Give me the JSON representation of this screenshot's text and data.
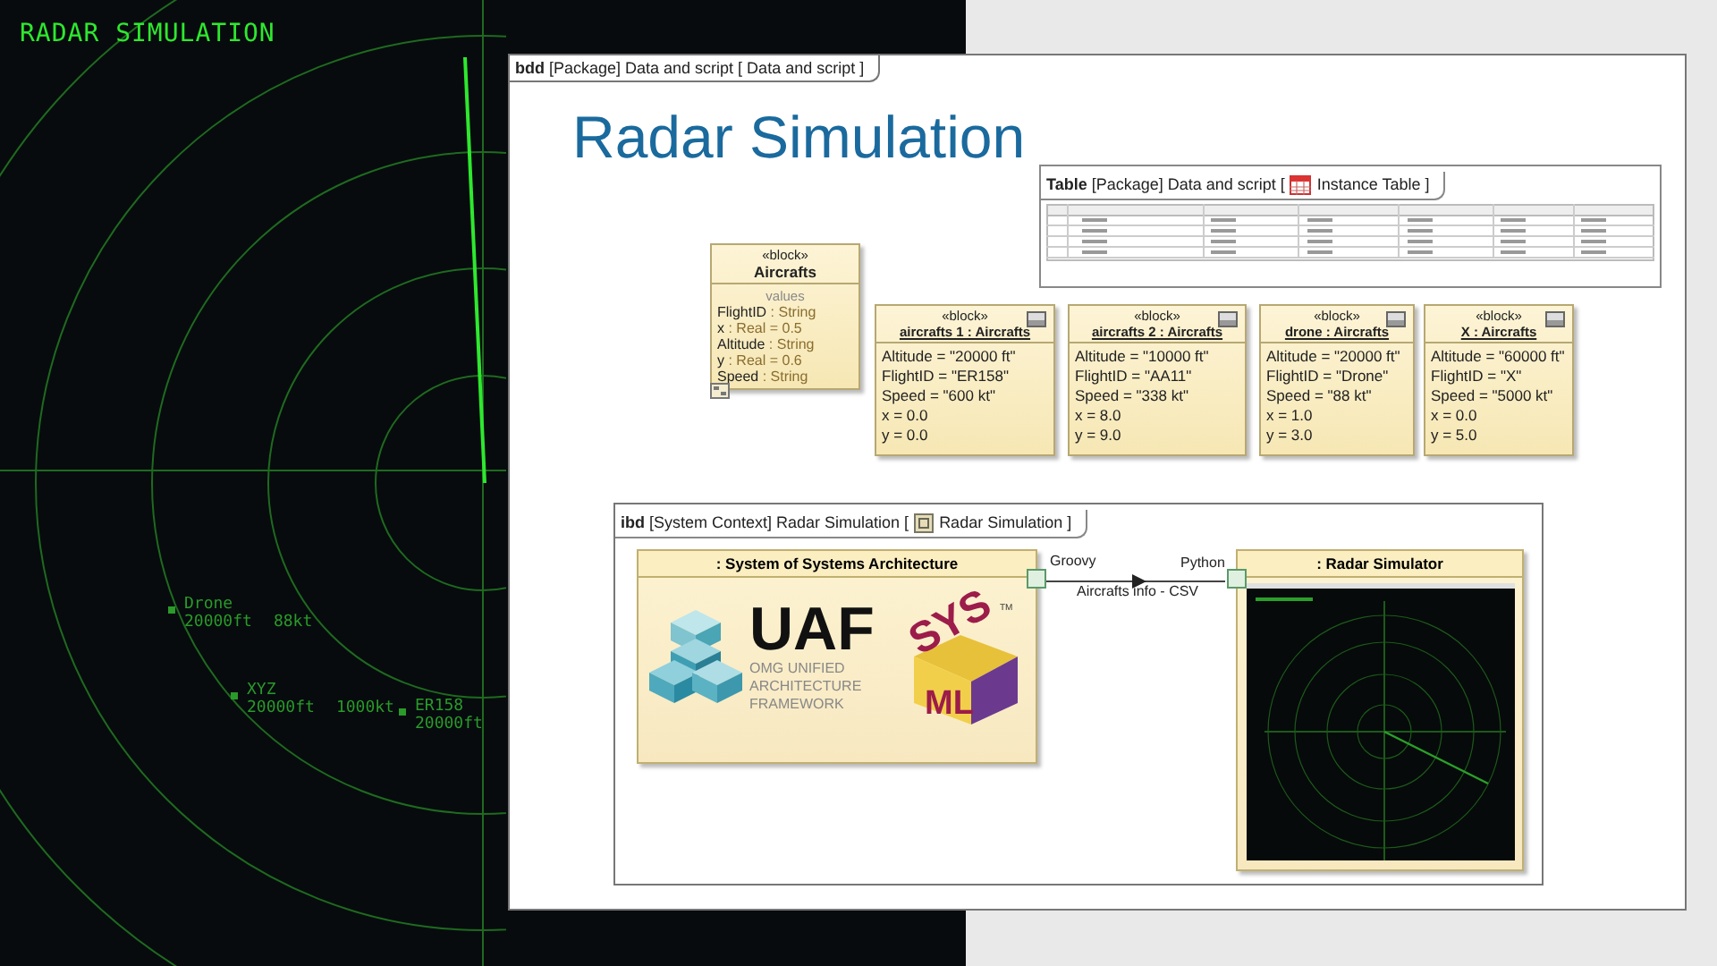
{
  "radar": {
    "title": "RADAR SIMULATION",
    "targets": [
      {
        "id": "Drone",
        "altitude": "20000ft",
        "speed": "88kt"
      },
      {
        "id": "XYZ",
        "altitude": "20000ft",
        "speed": "1000kt"
      },
      {
        "id": "ER158",
        "altitude": "20000ft"
      }
    ]
  },
  "diagram": {
    "frame_label": "**bdd** [Package] Data and script [ Data and script ]",
    "title": "Radar Simulation",
    "table": {
      "label_before": "**Table** [Package] Data and script [",
      "label_after": "Instance Table ]"
    },
    "block": {
      "stereotype": "«block»",
      "name": "Aircrafts",
      "compartment": "values",
      "properties": [
        {
          "name": "FlightID",
          "rest": ": String"
        },
        {
          "name": "x",
          "rest": ": Real = 0.5"
        },
        {
          "name": "Altitude",
          "rest": ": String"
        },
        {
          "name": "y",
          "rest": ": Real = 0.6"
        },
        {
          "name": "Speed",
          "rest": ": String"
        }
      ]
    },
    "instances": [
      {
        "stereotype": "«block»",
        "name": "aircrafts 1 : Aircrafts",
        "slots": [
          "Altitude = \"20000 ft\"",
          "FlightID = \"ER158\"",
          "Speed = \"600 kt\"",
          "x = 0.0",
          "y = 0.0"
        ]
      },
      {
        "stereotype": "«block»",
        "name": "aircrafts 2 : Aircrafts",
        "slots": [
          "Altitude = \"10000 ft\"",
          "FlightID = \"AA11\"",
          "Speed = \"338 kt\"",
          "x = 8.0",
          "y = 9.0"
        ]
      },
      {
        "stereotype": "«block»",
        "name": "drone : Aircrafts",
        "slots": [
          "Altitude = \"20000 ft\"",
          "FlightID = \"Drone\"",
          "Speed = \"88 kt\"",
          "x = 1.0",
          "y = 3.0"
        ]
      },
      {
        "stereotype": "«block»",
        "name": "X : Aircrafts",
        "slots": [
          "Altitude = \"60000 ft\"",
          "FlightID = \"X\"",
          "Speed = \"5000 kt\"",
          "x = 0.0",
          "y = 5.0"
        ]
      }
    ],
    "ibd": {
      "label_before": "**ibd** [System Context] Radar Simulation [",
      "label_after": "Radar Simulation ]",
      "source_part": ": System of Systems Architecture",
      "target_part": ": Radar Simulator",
      "source_port_label": "Groovy",
      "target_port_label": "Python",
      "connector_label": "Aircrafts info - CSV",
      "uaf_logo": {
        "title": "UAF",
        "lines": [
          "OMG UNIFIED",
          "ARCHITECTURE",
          "FRAMEWORK"
        ]
      },
      "sysml_logo": {
        "top": "SYS",
        "bottom": "ML",
        "mark": "TM"
      }
    }
  }
}
